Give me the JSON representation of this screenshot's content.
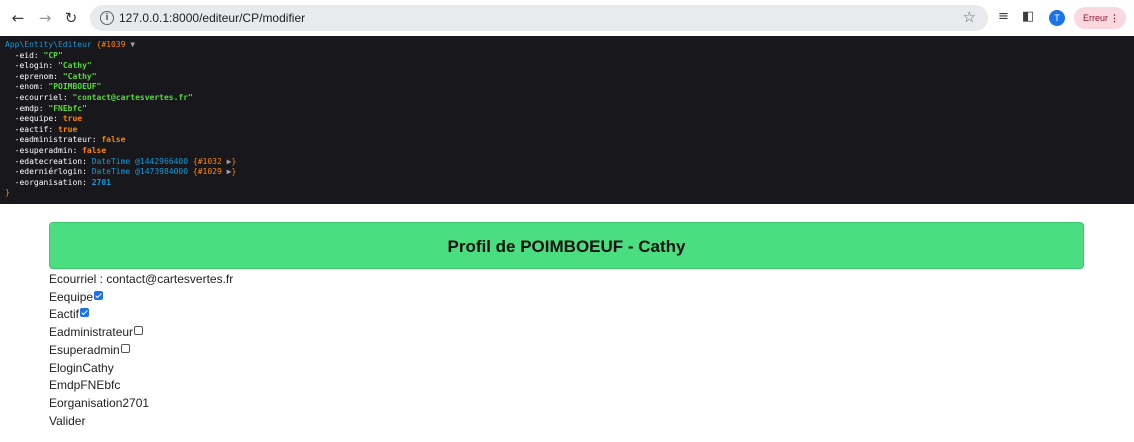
{
  "browser": {
    "url": "127.0.0.1:8000/editeur/CP/modifier",
    "error_label": "Erreur",
    "avatar_letter": "T"
  },
  "dump": {
    "class_name": "App\\Entity\\Editeur",
    "ref": "{#1039",
    "close": "}",
    "props": [
      {
        "key": "-eid",
        "value": "\"CP\"",
        "type": "str"
      },
      {
        "key": "-elogin",
        "value": "\"Cathy\"",
        "type": "str"
      },
      {
        "key": "-eprenom",
        "value": "\"Cathy\"",
        "type": "str"
      },
      {
        "key": "-enom",
        "value": "\"POIMBOEUF\"",
        "type": "str"
      },
      {
        "key": "-ecourriel",
        "value": "\"contact@cartesvertes.fr\"",
        "type": "str"
      },
      {
        "key": "-emdp",
        "value": "\"FNEbfc\"",
        "type": "str"
      },
      {
        "key": "-eequipe",
        "value": "true",
        "type": "bool"
      },
      {
        "key": "-eactif",
        "value": "true",
        "type": "bool"
      },
      {
        "key": "-eadministrateur",
        "value": "false",
        "type": "bool"
      },
      {
        "key": "-esuperadmin",
        "value": "false",
        "type": "bool"
      },
      {
        "key": "-edatecreation",
        "value": "DateTime @1442966400",
        "type": "obj",
        "ref": "{#1032"
      },
      {
        "key": "-ederniérlogin",
        "value": "DateTime @1473984000",
        "type": "obj",
        "ref": "{#1029"
      },
      {
        "key": "-eorganisation",
        "value": "2701",
        "type": "num"
      }
    ]
  },
  "profile": {
    "title": "Profil de POIMBOEUF - Cathy",
    "courriel": "Ecourriel : contact@cartesvertes.fr",
    "equipe_label": "Eequipe",
    "equipe_checked": true,
    "actif_label": "Eactif",
    "actif_checked": true,
    "administrateur_label": "Eadministrateur",
    "administrateur_checked": false,
    "superadmin_label": "Esuperadmin",
    "superadmin_checked": false,
    "login": "EloginCathy",
    "mdp": "EmdpFNEbfc",
    "organisation": "Eorganisation2701",
    "submit": "Valider"
  }
}
